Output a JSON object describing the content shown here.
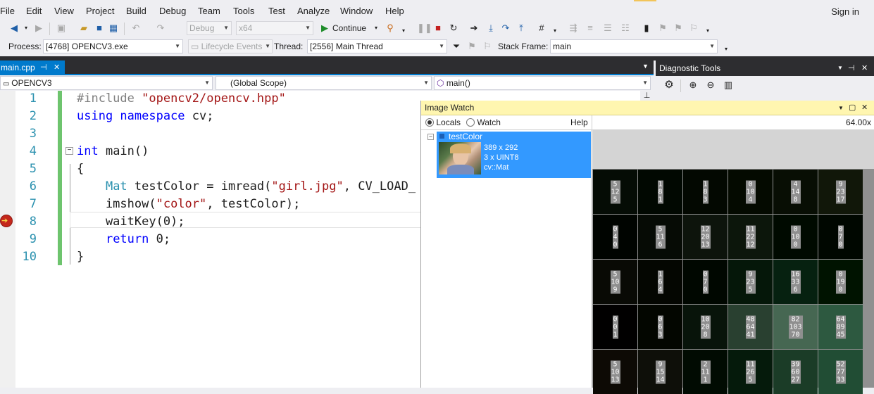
{
  "menu": [
    "File",
    "Edit",
    "View",
    "Project",
    "Build",
    "Debug",
    "Team",
    "Tools",
    "Test",
    "Analyze",
    "Window",
    "Help"
  ],
  "signin": "Sign in",
  "toolbar": {
    "config": "Debug",
    "platform": "x64",
    "continue_label": "Continue"
  },
  "debugbar": {
    "process_label": "Process:",
    "process_value": "[4768] OPENCV3.exe",
    "lifecycle_label": "Lifecycle Events",
    "thread_label": "Thread:",
    "thread_value": "[2556] Main Thread",
    "stackframe_label": "Stack Frame:",
    "stackframe_value": "main"
  },
  "doc_tab": {
    "name": "main.cpp",
    "pin": "⊣",
    "close": "✕"
  },
  "navbar": {
    "project": "OPENCV3",
    "scope": "(Global Scope)",
    "member": "main()"
  },
  "editor": {
    "line_numbers": [
      "1",
      "2",
      "3",
      "4",
      "5",
      "6",
      "7",
      "8",
      "9",
      "10"
    ]
  },
  "diagnostic": {
    "title": "Diagnostic Tools"
  },
  "imagewatch": {
    "title": "Image Watch",
    "locals_label": "Locals",
    "watch_label": "Watch",
    "help_label": "Help",
    "zoom": "64.00x",
    "item": {
      "name": "testColor",
      "dims": "389 x 292",
      "channels": "3 x UINT8",
      "type": "cv::Mat"
    },
    "pixels": [
      [
        [
          "5",
          "12",
          "5"
        ],
        [
          "1",
          "8",
          "1"
        ],
        [
          "1",
          "8",
          "3"
        ],
        [
          "0",
          "10",
          "4"
        ],
        [
          "4",
          "14",
          "8"
        ],
        [
          "9",
          "23",
          "17"
        ]
      ],
      [
        [
          "0",
          "4",
          "0"
        ],
        [
          "5",
          "11",
          "6"
        ],
        [
          "12",
          "20",
          "13"
        ],
        [
          "11",
          "22",
          "12"
        ],
        [
          "0",
          "10",
          "0"
        ],
        [
          "0",
          "7",
          "0"
        ]
      ],
      [
        [
          "5",
          "10",
          "9"
        ],
        [
          "1",
          "6",
          "4"
        ],
        [
          "0",
          "7",
          "0"
        ],
        [
          "9",
          "23",
          "5"
        ],
        [
          "16",
          "33",
          "6"
        ],
        [
          "0",
          "19",
          "0"
        ]
      ],
      [
        [
          "0",
          "0",
          "1"
        ],
        [
          "0",
          "6",
          "3"
        ],
        [
          "10",
          "20",
          "8"
        ],
        [
          "48",
          "64",
          "41"
        ],
        [
          "82",
          "103",
          "70"
        ],
        [
          "64",
          "89",
          "45"
        ]
      ],
      [
        [
          "5",
          "10",
          "13"
        ],
        [
          "9",
          "15",
          "14"
        ],
        [
          "2",
          "11",
          "1"
        ],
        [
          "11",
          "26",
          "5"
        ],
        [
          "39",
          "60",
          "27"
        ],
        [
          "52",
          "77",
          "33"
        ]
      ]
    ]
  }
}
